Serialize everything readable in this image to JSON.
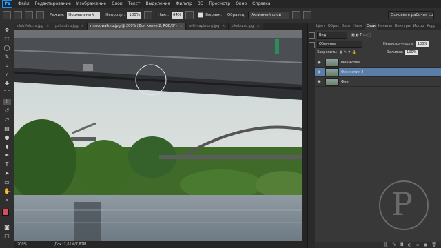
{
  "app": {
    "logo": "Ps"
  },
  "menu": [
    "Файл",
    "Редактирование",
    "Изображение",
    "Слои",
    "Текст",
    "Выделение",
    "Фильтр",
    "3D",
    "Просмотр",
    "Окно",
    "Справка"
  ],
  "options": {
    "mode_label": "Режим:",
    "mode_value": "Нормальный",
    "opacity_label": "Непрозр.:",
    "opacity_value": "100%",
    "flow_label": "Наж.:",
    "flow_value": "64%",
    "aligned_label": "Выравн.",
    "sample_label": "Образец:",
    "sample_value": "Активный слой",
    "workspace": "Основная рабочая среда"
  },
  "tabs": [
    {
      "label": "club.foto.ru.jpg",
      "active": false
    },
    {
      "label": "palbird.ru.jpg",
      "active": false
    },
    {
      "label": "moscowalk.ru.jpg @ 200% (Фон копия 2, RGB/8*)",
      "active": true
    },
    {
      "label": "wikimapia.org.jpg",
      "active": false
    },
    {
      "label": "pikabu.ru.jpg",
      "active": false
    }
  ],
  "status": {
    "zoom": "200%",
    "doc": "Док: 2,61M/7,82M"
  },
  "panel": {
    "tabs": [
      "Цвет",
      "Образ",
      "Эксо",
      "Навиг",
      "Слои",
      "Каналы",
      "Контуры",
      "Истор",
      "Корр"
    ],
    "active_tab": "Слои",
    "kind_value": "Вид",
    "blend_value": "Обычные",
    "opacity_label": "Непрозрачность:",
    "opacity_value": "100%",
    "lock_label": "Закрепить:",
    "fill_label": "Заливка:",
    "fill_value": "100%"
  },
  "layers": [
    {
      "name": "Фон копия",
      "selected": false
    },
    {
      "name": "Фон копия 2",
      "selected": true
    },
    {
      "name": "Фон",
      "selected": false
    }
  ],
  "colors": {
    "accent": "#5a7ea8",
    "foreground": "#d94a5a",
    "background": "#ffffff"
  }
}
